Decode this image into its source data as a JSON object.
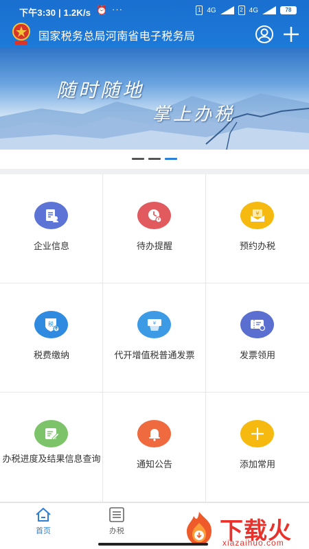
{
  "status_bar": {
    "time_speed": "下午3:30 | 1.2K/s",
    "battery": "78",
    "network1": "4G",
    "network2": "4G"
  },
  "header": {
    "title": "国家税务总局河南省电子税务局",
    "user_icon": "user-icon",
    "add_icon": "plus-icon",
    "accent_color": "#1d7ad8"
  },
  "banner": {
    "slogan_line1": "随时随地",
    "slogan_line2": "掌上办税",
    "slide_count": 3,
    "active_slide": 3
  },
  "grid": [
    {
      "label": "企业信息",
      "icon": "enterprise-info-icon",
      "color": "#5b74d6"
    },
    {
      "label": "待办提醒",
      "icon": "todo-reminder-icon",
      "color": "#e05a5e"
    },
    {
      "label": "预约办税",
      "icon": "appointment-icon",
      "color": "#f5b90f"
    },
    {
      "label": "税费缴纳",
      "icon": "tax-payment-icon",
      "color": "#2e8be0"
    },
    {
      "label": "代开增值税普通发票",
      "icon": "invoice-issue-icon",
      "color": "#3d9be6"
    },
    {
      "label": "发票领用",
      "icon": "invoice-collect-icon",
      "color": "#5b6fd1"
    },
    {
      "label": "办税进度及结果信息查询",
      "icon": "progress-query-icon",
      "color": "#7cc36a"
    },
    {
      "label": "通知公告",
      "icon": "notice-bell-icon",
      "color": "#ef6a3f"
    },
    {
      "label": "添加常用",
      "icon": "add-plus-icon",
      "color": "#f5b90f"
    }
  ],
  "tabs": [
    {
      "label": "首页",
      "icon": "home-icon",
      "active": true
    },
    {
      "label": "办税",
      "icon": "list-icon",
      "active": false
    }
  ],
  "watermark": {
    "text": "下载火",
    "sub": "xiazaihuo.com"
  }
}
